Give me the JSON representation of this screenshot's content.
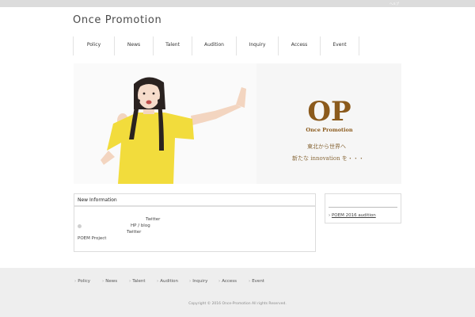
{
  "topbar": {
    "text": "ヘルプ"
  },
  "header": {
    "site_title": "Once Promotion"
  },
  "nav": {
    "items": [
      {
        "label": "Policy"
      },
      {
        "label": "News"
      },
      {
        "label": "Talent"
      },
      {
        "label": "Audition"
      },
      {
        "label": "Inquiry"
      },
      {
        "label": "Access"
      },
      {
        "label": "Event"
      }
    ]
  },
  "hero": {
    "logo_letters": "OP",
    "logo_text": "Once Promotion",
    "tagline_line1": "東北から世界へ",
    "tagline_line2": "新たな innovation を・・・"
  },
  "info": {
    "heading": "New Information",
    "line1": "Twitter",
    "line2a": "HP",
    "line2sep": "/",
    "line2b": "blog",
    "line3": "Twitter",
    "line4": "POEM Project"
  },
  "sidebar": {
    "link_prefix": "›",
    "link": "POEM 2016 audition"
  },
  "footer": {
    "chevron": "›",
    "items": [
      "Policy",
      "News",
      "Talent",
      "Audition",
      "Inquiry",
      "Access",
      "Event"
    ],
    "copyright": "Copyright © 2016 Once-Promotion All rights Reserved."
  },
  "colors": {
    "logo_brown": "#8b5a1c",
    "tagline": "#8a6a3c",
    "shirt_yellow": "#f2dc3c"
  }
}
